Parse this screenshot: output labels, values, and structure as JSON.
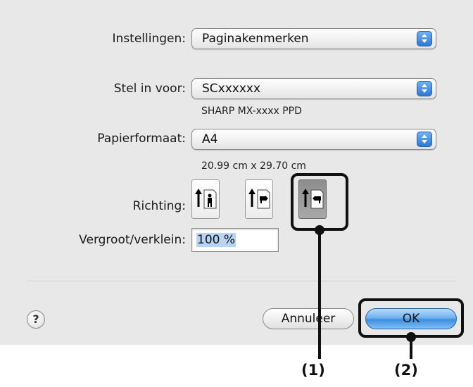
{
  "settings": {
    "instellingen_label": "Instellingen:",
    "instellingen_value": "Paginakenmerken",
    "stel_label": "Stel in voor:",
    "stel_value": "SCxxxxxx",
    "printer_info": "SHARP MX-xxxx PPD",
    "papier_label": "Papierformaat:",
    "papier_value": "A4",
    "papier_size": "20.99 cm x 29.70 cm",
    "richting_label": "Richting:",
    "schaal_label": "Vergroot/verklein:",
    "schaal_value": "100 %"
  },
  "orientation": {
    "options": [
      "portrait",
      "landscape",
      "reverse-landscape"
    ],
    "selected": "reverse-landscape"
  },
  "buttons": {
    "help": "?",
    "cancel": "Annuleer",
    "ok": "OK"
  },
  "callouts": {
    "one": "(1)",
    "two": "(2)"
  }
}
